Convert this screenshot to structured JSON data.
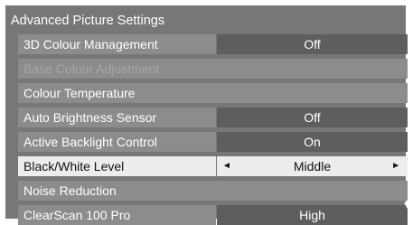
{
  "menu": {
    "title": "Advanced Picture Settings",
    "rows": [
      {
        "label": "3D Colour Management",
        "value": "Off"
      },
      {
        "label": "Base Colour Adjustment"
      },
      {
        "label": "Colour Temperature"
      },
      {
        "label": "Auto Brightness Sensor",
        "value": "Off"
      },
      {
        "label": "Active Backlight Control",
        "value": "On"
      },
      {
        "label": "Black/White Level",
        "value": "Middle",
        "left_arrow": "◄",
        "right_arrow": "►"
      },
      {
        "label": "Noise Reduction"
      },
      {
        "label": "ClearScan 100 Pro",
        "value": "High"
      }
    ],
    "selected_item": "Black/White Level",
    "disabled_item": "Base Colour Adjustment",
    "scroll_icon": "triangle-down-icon"
  }
}
